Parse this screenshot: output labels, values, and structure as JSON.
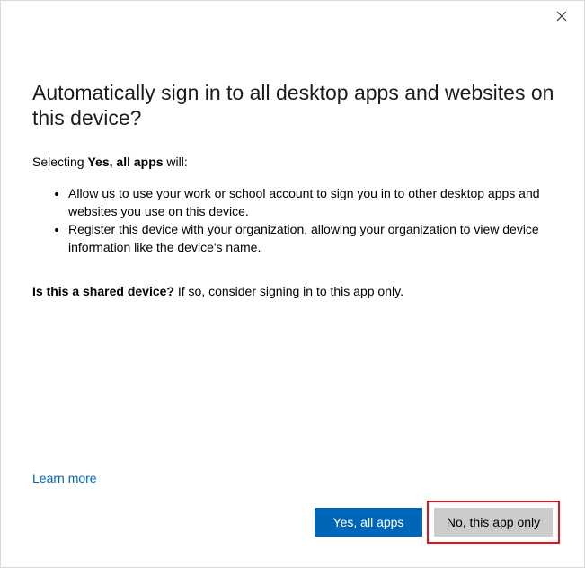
{
  "dialog": {
    "title": "Automatically sign in to all desktop apps and websites on this device?",
    "intro": {
      "prefix": "Selecting ",
      "bold": "Yes, all apps",
      "suffix": " will:"
    },
    "bullets": [
      "Allow us to use your work or school account to sign you in to other desktop apps and websites you use on this device.",
      "Register this device with your organization, allowing your organization to view device information like the device's name."
    ],
    "shared": {
      "bold": "Is this a shared device?",
      "rest": " If so, consider signing in to this app only."
    },
    "learn_more": "Learn more",
    "buttons": {
      "primary": "Yes, all apps",
      "secondary": "No, this app only"
    }
  },
  "icons": {
    "close": "close-icon"
  },
  "colors": {
    "accent": "#0067b8",
    "secondary_button": "#cccccc",
    "highlight": "#e0141e"
  }
}
